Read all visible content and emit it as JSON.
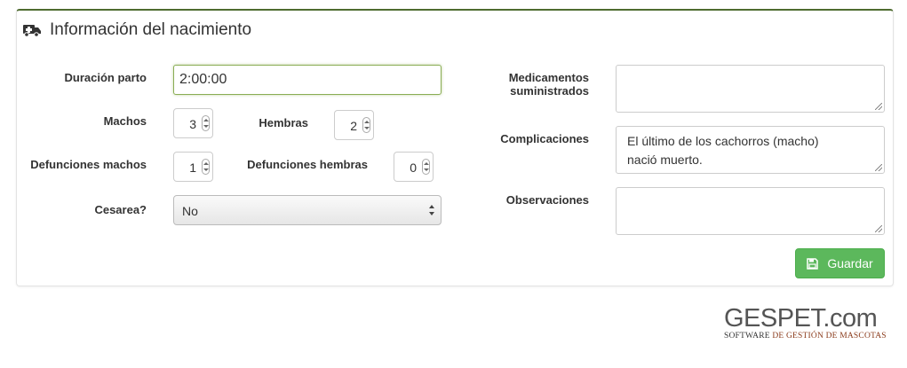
{
  "panel": {
    "title": "Información del nacimiento",
    "icon": "ambulance-icon"
  },
  "form": {
    "duracion_parto": {
      "label": "Duración parto",
      "value": "2:00:00"
    },
    "machos": {
      "label": "Machos",
      "value": "3"
    },
    "hembras": {
      "label": "Hembras",
      "value": "2"
    },
    "defunciones_machos": {
      "label": "Defunciones machos",
      "value": "1"
    },
    "defunciones_hembras": {
      "label": "Defunciones hembras",
      "value": "0"
    },
    "cesarea": {
      "label": "Cesarea?",
      "value": "No"
    },
    "medicamentos": {
      "label_line1": "Medicamentos",
      "label_line2": "suministrados",
      "value": ""
    },
    "complicaciones": {
      "label": "Complicaciones",
      "value_line1": "El último de los cachorros (macho)",
      "value_line2": "nació muerto."
    },
    "observaciones": {
      "label": "Observaciones",
      "value": ""
    }
  },
  "actions": {
    "save_label": "Guardar",
    "save_icon": "floppy-disk-icon"
  },
  "brand": {
    "name": "GESPET.com",
    "tagline_part1": "SOFTWARE ",
    "tagline_part2": "DE GESTIÓN DE MASCOTAS",
    "colors": {
      "accent": "#5cb85c",
      "header_border": "#4e6b2f",
      "tagline_accent": "#8a3a1a"
    }
  }
}
